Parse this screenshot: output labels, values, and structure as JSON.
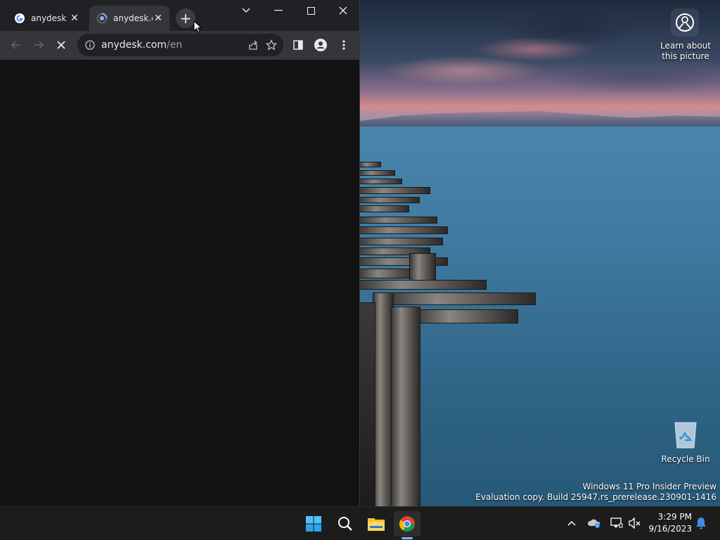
{
  "browser": {
    "tabs": [
      {
        "title": "anydesk -",
        "close": "✕",
        "active": false
      },
      {
        "title": "anydesk.c",
        "close": "✕",
        "active": true
      }
    ],
    "new_tab": "+",
    "address": {
      "host": "anydesk.com",
      "path": "/en"
    }
  },
  "desktop": {
    "learn_label": "Learn about this picture",
    "recycle_label": "Recycle Bin",
    "watermark": {
      "line1": "Windows 11 Pro Insider Preview",
      "line2": "Evaluation copy. Build 25947.rs_prerelease.230901-1416"
    }
  },
  "taskbar": {
    "apps": [
      "start-icon",
      "search-icon",
      "file-explorer-icon",
      "chrome-icon"
    ],
    "time": "3:29 PM",
    "date": "9/16/2023"
  }
}
